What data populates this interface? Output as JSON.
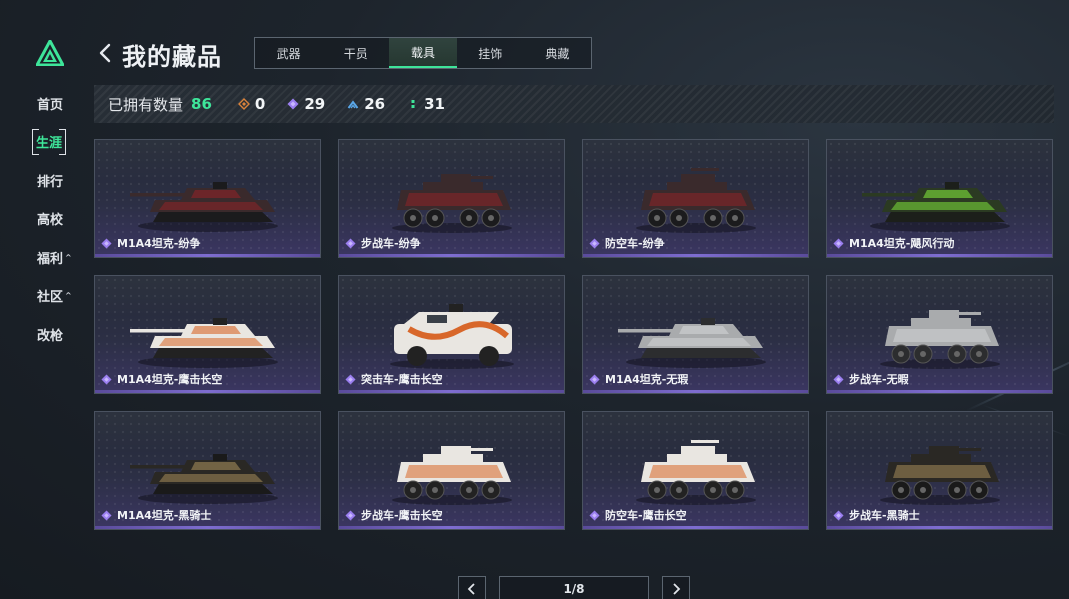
{
  "sidebar": {
    "items": [
      {
        "label": "首页",
        "caret": ""
      },
      {
        "label": "生涯",
        "caret": "",
        "active": true
      },
      {
        "label": "排行",
        "caret": ""
      },
      {
        "label": "高校",
        "caret": ""
      },
      {
        "label": "福利",
        "caret": "^"
      },
      {
        "label": "社区",
        "caret": "^"
      },
      {
        "label": "改枪",
        "caret": ""
      }
    ]
  },
  "header": {
    "title": "我的藏品",
    "tabs": [
      {
        "label": "武器"
      },
      {
        "label": "干员"
      },
      {
        "label": "载具",
        "active": true
      },
      {
        "label": "挂饰"
      },
      {
        "label": "典藏"
      }
    ]
  },
  "stats": {
    "owned_label": "已拥有数量",
    "owned_value": "86",
    "tiers": [
      {
        "icon": "orange-diamond-icon",
        "color": "#d9823b",
        "value": "0"
      },
      {
        "icon": "purple-diamond-icon",
        "color": "#9b7ff0",
        "value": "29"
      },
      {
        "icon": "blue-chevron-icon",
        "color": "#5aa7e8",
        "value": "26"
      },
      {
        "icon": "green-dot-icon",
        "color": "#3ee59a",
        "value": "31"
      }
    ]
  },
  "colors": {
    "accent": "#3ee59a",
    "rarity": "#9b7ff0"
  },
  "items": [
    {
      "name": "M1A4坦克-纷争",
      "kind": "tank",
      "skin": "dark-red"
    },
    {
      "name": "步战车-纷争",
      "kind": "ifv",
      "skin": "dark-red"
    },
    {
      "name": "防空车-纷争",
      "kind": "aa",
      "skin": "dark-red"
    },
    {
      "name": "M1A4坦克-飓风行动",
      "kind": "tank",
      "skin": "green"
    },
    {
      "name": "M1A4坦克-鹰击长空",
      "kind": "tank",
      "skin": "orange-white"
    },
    {
      "name": "突击车-鹰击长空",
      "kind": "assault",
      "skin": "orange-white"
    },
    {
      "name": "M1A4坦克-无瑕",
      "kind": "tank",
      "skin": "grey"
    },
    {
      "name": "步战车-无暇",
      "kind": "ifv",
      "skin": "grey"
    },
    {
      "name": "M1A4坦克-黑骑士",
      "kind": "tank",
      "skin": "black-tan"
    },
    {
      "name": "步战车-鹰击长空",
      "kind": "ifv",
      "skin": "orange-white"
    },
    {
      "name": "防空车-鹰击长空",
      "kind": "aa",
      "skin": "orange-white"
    },
    {
      "name": "步战车-黑骑士",
      "kind": "ifv",
      "skin": "black-tan"
    }
  ],
  "pager": {
    "label": "1/8"
  }
}
